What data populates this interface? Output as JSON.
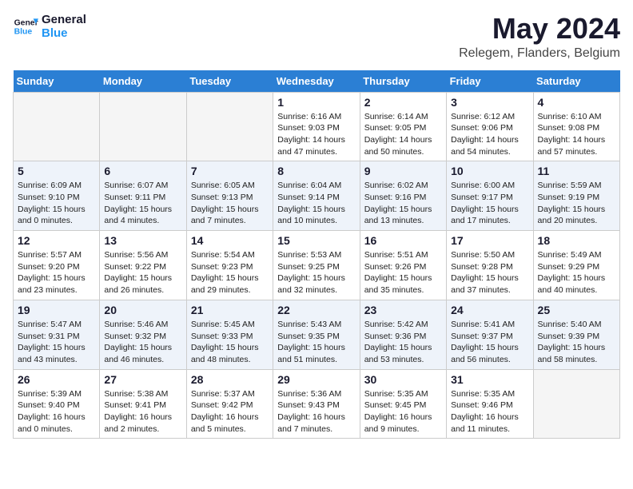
{
  "header": {
    "logo_line1": "General",
    "logo_line2": "Blue",
    "title": "May 2024",
    "subtitle": "Relegem, Flanders, Belgium"
  },
  "weekdays": [
    "Sunday",
    "Monday",
    "Tuesday",
    "Wednesday",
    "Thursday",
    "Friday",
    "Saturday"
  ],
  "weeks": [
    [
      {
        "day": "",
        "info": ""
      },
      {
        "day": "",
        "info": ""
      },
      {
        "day": "",
        "info": ""
      },
      {
        "day": "1",
        "info": "Sunrise: 6:16 AM\nSunset: 9:03 PM\nDaylight: 14 hours and 47 minutes."
      },
      {
        "day": "2",
        "info": "Sunrise: 6:14 AM\nSunset: 9:05 PM\nDaylight: 14 hours and 50 minutes."
      },
      {
        "day": "3",
        "info": "Sunrise: 6:12 AM\nSunset: 9:06 PM\nDaylight: 14 hours and 54 minutes."
      },
      {
        "day": "4",
        "info": "Sunrise: 6:10 AM\nSunset: 9:08 PM\nDaylight: 14 hours and 57 minutes."
      }
    ],
    [
      {
        "day": "5",
        "info": "Sunrise: 6:09 AM\nSunset: 9:10 PM\nDaylight: 15 hours and 0 minutes."
      },
      {
        "day": "6",
        "info": "Sunrise: 6:07 AM\nSunset: 9:11 PM\nDaylight: 15 hours and 4 minutes."
      },
      {
        "day": "7",
        "info": "Sunrise: 6:05 AM\nSunset: 9:13 PM\nDaylight: 15 hours and 7 minutes."
      },
      {
        "day": "8",
        "info": "Sunrise: 6:04 AM\nSunset: 9:14 PM\nDaylight: 15 hours and 10 minutes."
      },
      {
        "day": "9",
        "info": "Sunrise: 6:02 AM\nSunset: 9:16 PM\nDaylight: 15 hours and 13 minutes."
      },
      {
        "day": "10",
        "info": "Sunrise: 6:00 AM\nSunset: 9:17 PM\nDaylight: 15 hours and 17 minutes."
      },
      {
        "day": "11",
        "info": "Sunrise: 5:59 AM\nSunset: 9:19 PM\nDaylight: 15 hours and 20 minutes."
      }
    ],
    [
      {
        "day": "12",
        "info": "Sunrise: 5:57 AM\nSunset: 9:20 PM\nDaylight: 15 hours and 23 minutes."
      },
      {
        "day": "13",
        "info": "Sunrise: 5:56 AM\nSunset: 9:22 PM\nDaylight: 15 hours and 26 minutes."
      },
      {
        "day": "14",
        "info": "Sunrise: 5:54 AM\nSunset: 9:23 PM\nDaylight: 15 hours and 29 minutes."
      },
      {
        "day": "15",
        "info": "Sunrise: 5:53 AM\nSunset: 9:25 PM\nDaylight: 15 hours and 32 minutes."
      },
      {
        "day": "16",
        "info": "Sunrise: 5:51 AM\nSunset: 9:26 PM\nDaylight: 15 hours and 35 minutes."
      },
      {
        "day": "17",
        "info": "Sunrise: 5:50 AM\nSunset: 9:28 PM\nDaylight: 15 hours and 37 minutes."
      },
      {
        "day": "18",
        "info": "Sunrise: 5:49 AM\nSunset: 9:29 PM\nDaylight: 15 hours and 40 minutes."
      }
    ],
    [
      {
        "day": "19",
        "info": "Sunrise: 5:47 AM\nSunset: 9:31 PM\nDaylight: 15 hours and 43 minutes."
      },
      {
        "day": "20",
        "info": "Sunrise: 5:46 AM\nSunset: 9:32 PM\nDaylight: 15 hours and 46 minutes."
      },
      {
        "day": "21",
        "info": "Sunrise: 5:45 AM\nSunset: 9:33 PM\nDaylight: 15 hours and 48 minutes."
      },
      {
        "day": "22",
        "info": "Sunrise: 5:43 AM\nSunset: 9:35 PM\nDaylight: 15 hours and 51 minutes."
      },
      {
        "day": "23",
        "info": "Sunrise: 5:42 AM\nSunset: 9:36 PM\nDaylight: 15 hours and 53 minutes."
      },
      {
        "day": "24",
        "info": "Sunrise: 5:41 AM\nSunset: 9:37 PM\nDaylight: 15 hours and 56 minutes."
      },
      {
        "day": "25",
        "info": "Sunrise: 5:40 AM\nSunset: 9:39 PM\nDaylight: 15 hours and 58 minutes."
      }
    ],
    [
      {
        "day": "26",
        "info": "Sunrise: 5:39 AM\nSunset: 9:40 PM\nDaylight: 16 hours and 0 minutes."
      },
      {
        "day": "27",
        "info": "Sunrise: 5:38 AM\nSunset: 9:41 PM\nDaylight: 16 hours and 2 minutes."
      },
      {
        "day": "28",
        "info": "Sunrise: 5:37 AM\nSunset: 9:42 PM\nDaylight: 16 hours and 5 minutes."
      },
      {
        "day": "29",
        "info": "Sunrise: 5:36 AM\nSunset: 9:43 PM\nDaylight: 16 hours and 7 minutes."
      },
      {
        "day": "30",
        "info": "Sunrise: 5:35 AM\nSunset: 9:45 PM\nDaylight: 16 hours and 9 minutes."
      },
      {
        "day": "31",
        "info": "Sunrise: 5:35 AM\nSunset: 9:46 PM\nDaylight: 16 hours and 11 minutes."
      },
      {
        "day": "",
        "info": ""
      }
    ]
  ]
}
